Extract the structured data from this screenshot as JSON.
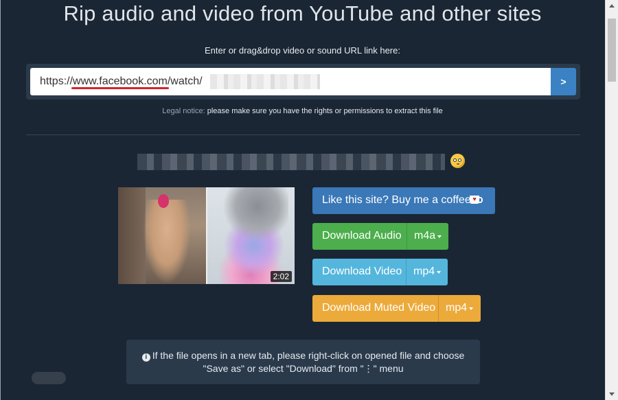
{
  "page": {
    "title": "Rip audio and video from YouTube and other sites",
    "url_hint": "Enter or drag&drop video or sound URL link here:"
  },
  "url_input": {
    "value": "https://www.facebook.com/watch/",
    "go_label": ">"
  },
  "legal": {
    "label": "Legal notice:",
    "text": "please make sure you have the rights or permissions to extract this file"
  },
  "video": {
    "duration": "2:02"
  },
  "buttons": {
    "coffee": "Like this site? Buy me a coffee",
    "audio": "Download Audio",
    "audio_format": "m4a",
    "video": "Download Video",
    "video_format": "mp4",
    "muted": "Download Muted Video",
    "muted_format": "mp4"
  },
  "info": {
    "line1": "If the file opens in a new tab, please right-click on opened file and choose",
    "line2": "\"Save as\" or select \"Download\" from \"⋮\" menu"
  },
  "colors": {
    "background": "#1a2634",
    "primary": "#3a78b8",
    "success": "#4cae4c",
    "info": "#54b6dc",
    "warning": "#ecaa3b"
  },
  "icons": [
    "info-icon",
    "coffee-cup-icon",
    "emoji-face-icon",
    "caret-down-icon"
  ]
}
